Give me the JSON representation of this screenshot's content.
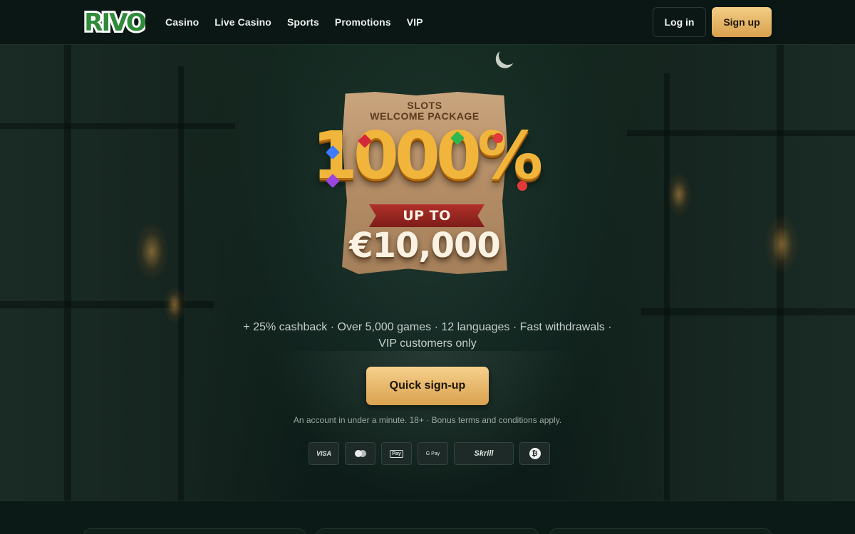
{
  "brand": {
    "logo_text": "RIVO"
  },
  "nav": {
    "items": [
      {
        "label": "Casino"
      },
      {
        "label": "Live Casino"
      },
      {
        "label": "Sports"
      },
      {
        "label": "Promotions"
      },
      {
        "label": "VIP"
      }
    ]
  },
  "auth": {
    "login_label": "Log in",
    "signup_label": "Sign up"
  },
  "promo": {
    "line1": "SLOTS",
    "line2": "WELCOME PACKAGE",
    "percent": "1000%",
    "up_to": "UP TO",
    "amount": "€10,000"
  },
  "hero": {
    "tagline": "+ 25% cashback · Over 5,000 games · 12 languages · Fast withdrawals · VIP customers only",
    "cta_label": "Quick sign-up",
    "disclaimer": "An account in under a minute. 18+ · Bonus terms and conditions apply."
  },
  "payments": [
    {
      "name": "visa-icon",
      "label": "VISA"
    },
    {
      "name": "mastercard-icon",
      "label": ""
    },
    {
      "name": "apple-pay-icon",
      "label": "Pay"
    },
    {
      "name": "google-pay-icon",
      "label": "G Pay"
    },
    {
      "name": "skrill-icon",
      "label": "Skrill"
    },
    {
      "name": "bitcoin-icon",
      "label": "₿"
    }
  ],
  "colors": {
    "accent_gold": "#e3b063",
    "background": "#0b1a16",
    "logo_green": "#2f8a3a"
  }
}
